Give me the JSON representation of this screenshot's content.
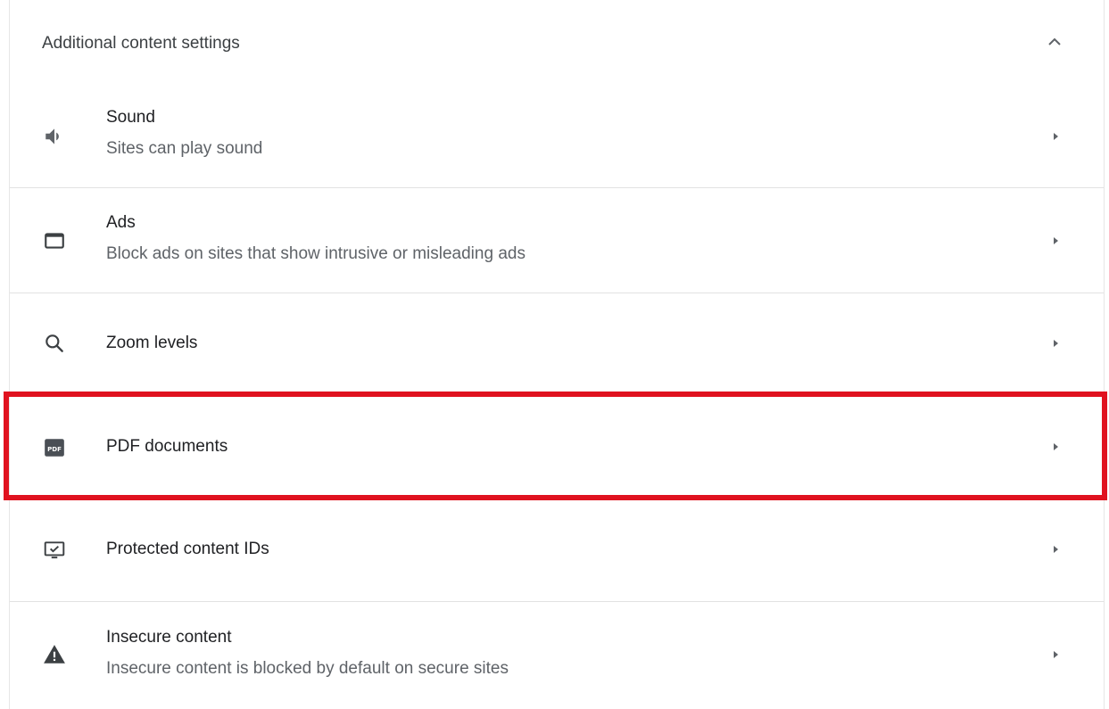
{
  "section": {
    "title": "Additional content settings",
    "collapse_icon": "chevron-up-icon"
  },
  "rows": [
    {
      "name": "sound",
      "icon": "speaker-icon",
      "title": "Sound",
      "subtitle": "Sites can play sound"
    },
    {
      "name": "ads",
      "icon": "window-icon",
      "title": "Ads",
      "subtitle": "Block ads on sites that show intrusive or misleading ads"
    },
    {
      "name": "zoom-levels",
      "icon": "search-icon",
      "title": "Zoom levels"
    },
    {
      "name": "pdf-documents",
      "icon": "pdf-icon",
      "title": "PDF documents",
      "highlighted": true
    },
    {
      "name": "protected-content-ids",
      "icon": "monitor-check-icon",
      "title": "Protected content IDs"
    },
    {
      "name": "insecure-content",
      "icon": "warning-icon",
      "title": "Insecure content",
      "subtitle": "Insecure content is blocked by default on secure sites"
    }
  ],
  "colors": {
    "highlight": "#e0121f",
    "icon": "#5f6368"
  }
}
